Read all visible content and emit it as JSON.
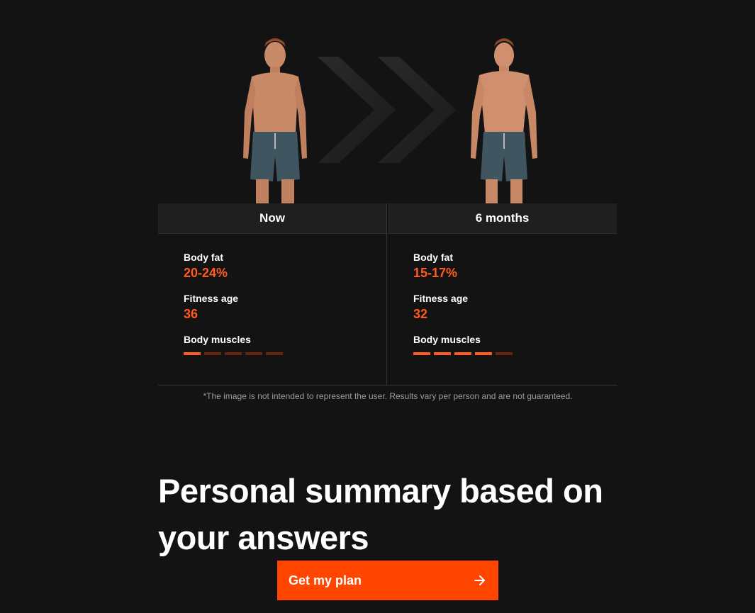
{
  "comparison": {
    "now": {
      "heading": "Now",
      "body_fat_label": "Body fat",
      "body_fat_value": "20-24%",
      "fitness_age_label": "Fitness age",
      "fitness_age_value": "36",
      "body_muscles_label": "Body muscles",
      "body_muscles_level": 1,
      "body_muscles_max": 5
    },
    "later": {
      "heading": "6 months",
      "body_fat_label": "Body fat",
      "body_fat_value": "15-17%",
      "fitness_age_label": "Fitness age",
      "fitness_age_value": "32",
      "body_muscles_label": "Body muscles",
      "body_muscles_level": 4,
      "body_muscles_max": 5
    }
  },
  "disclaimer": "*The image is not intended to represent the user. Results vary per person and are not guaranteed.",
  "summary": {
    "title": "Personal summary based on your answers"
  },
  "cta": {
    "label": "Get my plan",
    "icon": "arrow-right-icon"
  },
  "colors": {
    "accent": "#ff5a1f",
    "button": "#ff4500",
    "background": "#131313",
    "bar_off": "#6a2410"
  }
}
